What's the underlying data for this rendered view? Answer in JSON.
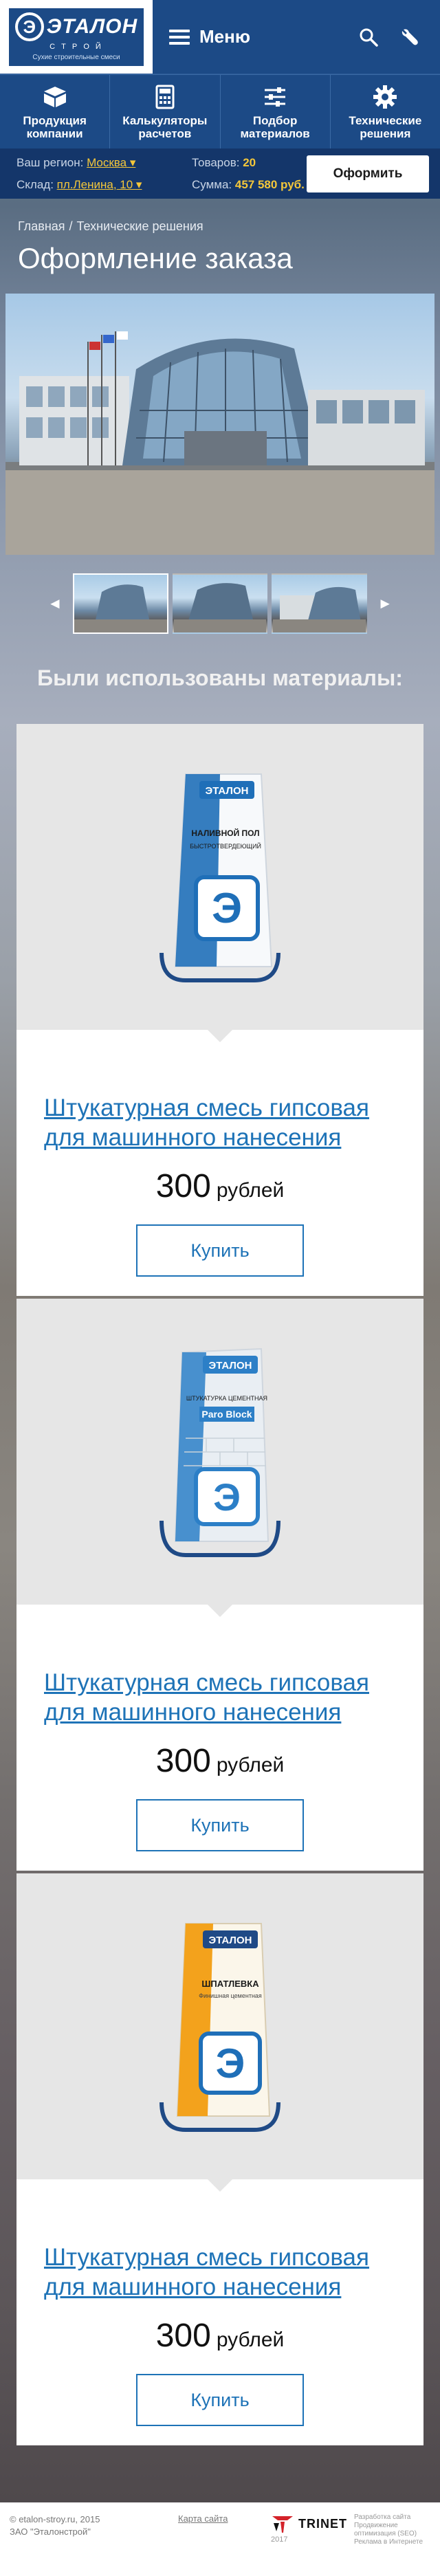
{
  "header": {
    "logo_word": "ЭТАЛОН",
    "logo_sub": "С Т Р О Й",
    "logo_tagline": "Сухие строительные смеси",
    "menu_label": "Меню"
  },
  "quicknav": [
    {
      "label_1": "Продукция",
      "label_2": "компании",
      "icon": "boxes-icon"
    },
    {
      "label_1": "Калькуляторы",
      "label_2": "расчетов",
      "icon": "calculator-icon"
    },
    {
      "label_1": "Подбор",
      "label_2": "материалов",
      "icon": "sliders-icon"
    },
    {
      "label_1": "Технические",
      "label_2": "решения",
      "icon": "gear-icon"
    }
  ],
  "cart": {
    "region_label": "Ваш регион:",
    "region_value": "Москва ▾",
    "warehouse_label": "Склад:",
    "warehouse_value": "пл.Ленина, 10 ▾",
    "goods_label": "Товаров:",
    "goods_value": "20",
    "sum_label": "Сумма:",
    "sum_value": "457 580 руб.",
    "order_button": "Оформить"
  },
  "breadcrumb": {
    "home": "Главная",
    "separator": "/",
    "current": "Технические решения"
  },
  "page_title": "Оформление заказа",
  "gallery": {
    "prev": "◄",
    "next": "►"
  },
  "materials_title": "Были использованы материалы:",
  "products": [
    {
      "name": "Штукатурная смесь гипсовая для машинного нанесения",
      "price": "300",
      "currency": "рублей",
      "buy_label": "Купить",
      "bag_brand": "ЭТАЛОН",
      "bag_title": "НАЛИВНОЙ ПОЛ",
      "bag_desc": "БЫСТРОТВЕРДЕЮЩИЙ",
      "bag_color": "#1f6fb8"
    },
    {
      "name": "Штукатурная смесь гипсовая для машинного нанесения",
      "price": "300",
      "currency": "рублей",
      "buy_label": "Купить",
      "bag_brand": "ЭТАЛОН",
      "bag_title": "Paro Block",
      "bag_desc": "ШТУКАТУРКА ЦЕМЕНТНАЯ",
      "bag_color": "#2c7fc7"
    },
    {
      "name": "Штукатурная смесь гипсовая для машинного нанесения",
      "price": "300",
      "currency": "рублей",
      "buy_label": "Купить",
      "bag_brand": "ЭТАЛОН",
      "bag_title": "ШПАТЛЕВКА",
      "bag_desc": "Финишная цементная",
      "bag_color": "#f3a21c"
    }
  ],
  "footer": {
    "copyright": "© etalon-stroy.ru, 2015",
    "company": "ЗАО \"Эталонстрой\"",
    "sitemap": "Карта сайта",
    "dev_brand": "TRINET",
    "dev_year": "2017",
    "dev_desc_1": "Разработка сайта",
    "dev_desc_2": "Продвижение",
    "dev_desc_3": "оптимизация (SEO)",
    "dev_desc_4": "Реклама в Интернете"
  }
}
